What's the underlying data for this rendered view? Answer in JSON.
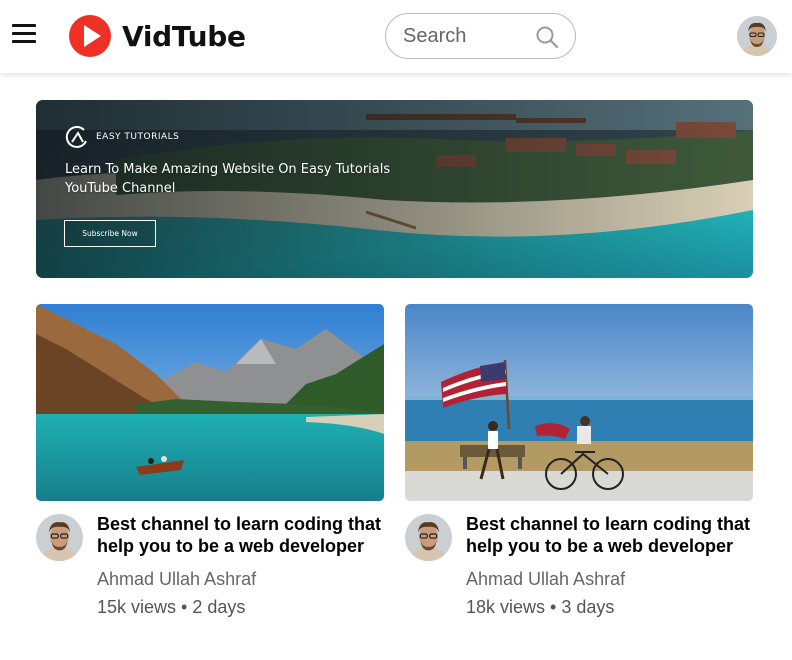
{
  "app": {
    "name": "VidTube",
    "brand_color": "#ee3124"
  },
  "navbar": {
    "menu_icon": "hamburger-menu-icon",
    "logo_icon": "play-circle-icon",
    "search": {
      "placeholder": "Search",
      "icon": "search-icon"
    },
    "user_avatar": "user-avatar"
  },
  "banner": {
    "brand": "EASY TUTORIALS",
    "brand_icon": "easy-tutorials-logo-icon",
    "title_line1": "Learn To Make Amazing Website On Easy Tutorials",
    "title_line2": "YouTube Channel",
    "button_label": "Subscribe Now"
  },
  "videos": [
    {
      "title_line1": "Best channel to learn coding that",
      "title_line2": "help you to be a web developer",
      "channel": "Ahmad Ullah Ashraf",
      "views": "15k views",
      "age": "2 days",
      "thumbnail": "mountain-lake-boat"
    },
    {
      "title_line1": "Best channel to learn coding that",
      "title_line2": "help you to be a web developer",
      "channel": "Ahmad Ullah Ashraf",
      "views": "18k views",
      "age": "3 days",
      "thumbnail": "beach-flag-bicycle"
    }
  ],
  "separator": "•"
}
